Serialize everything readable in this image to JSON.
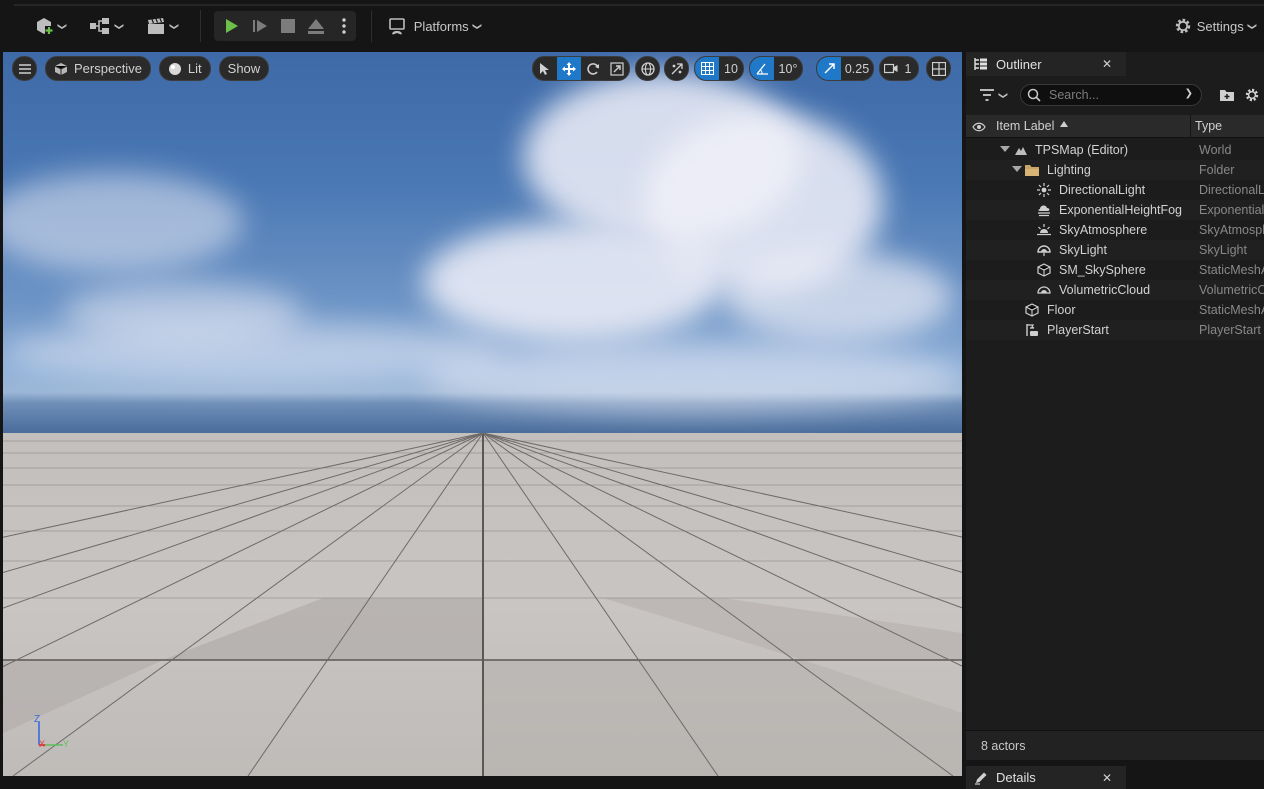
{
  "toolbar": {
    "platforms_label": "Platforms",
    "settings_label": "Settings"
  },
  "viewport": {
    "menu_icon": "hamburger-icon",
    "perspective_label": "Perspective",
    "lit_label": "Lit",
    "show_label": "Show",
    "grid_snap_value": "10",
    "rotation_snap_value": "10°",
    "scale_snap_value": "0.25",
    "camera_speed_value": "1",
    "axis": {
      "z": "Z",
      "x": "X",
      "y": "Y"
    }
  },
  "outliner": {
    "tab_label": "Outliner",
    "close_glyph": "✕",
    "search_placeholder": "Search...",
    "header": {
      "item_label": "Item Label",
      "type": "Type"
    },
    "rows": [
      {
        "label": "TPSMap (Editor)",
        "type": "World",
        "icon": "world-icon"
      },
      {
        "label": "Lighting",
        "type": "Folder",
        "icon": "folder-icon"
      },
      {
        "label": "DirectionalLight",
        "type": "DirectionalLight",
        "icon": "directional-light-icon"
      },
      {
        "label": "ExponentialHeightFog",
        "type": "ExponentialHeightFog",
        "icon": "fog-icon"
      },
      {
        "label": "SkyAtmosphere",
        "type": "SkyAtmosphere",
        "icon": "sky-atmosphere-icon"
      },
      {
        "label": "SkyLight",
        "type": "SkyLight",
        "icon": "skylight-icon"
      },
      {
        "label": "SM_SkySphere",
        "type": "StaticMeshActor",
        "icon": "static-mesh-icon"
      },
      {
        "label": "VolumetricCloud",
        "type": "VolumetricCloud",
        "icon": "cloud-icon"
      },
      {
        "label": "Floor",
        "type": "StaticMeshActor",
        "icon": "static-mesh-icon"
      },
      {
        "label": "PlayerStart",
        "type": "PlayerStart",
        "icon": "player-start-icon"
      }
    ],
    "footer": "8 actors"
  },
  "details": {
    "tab_label": "Details",
    "close_glyph": "✕"
  }
}
